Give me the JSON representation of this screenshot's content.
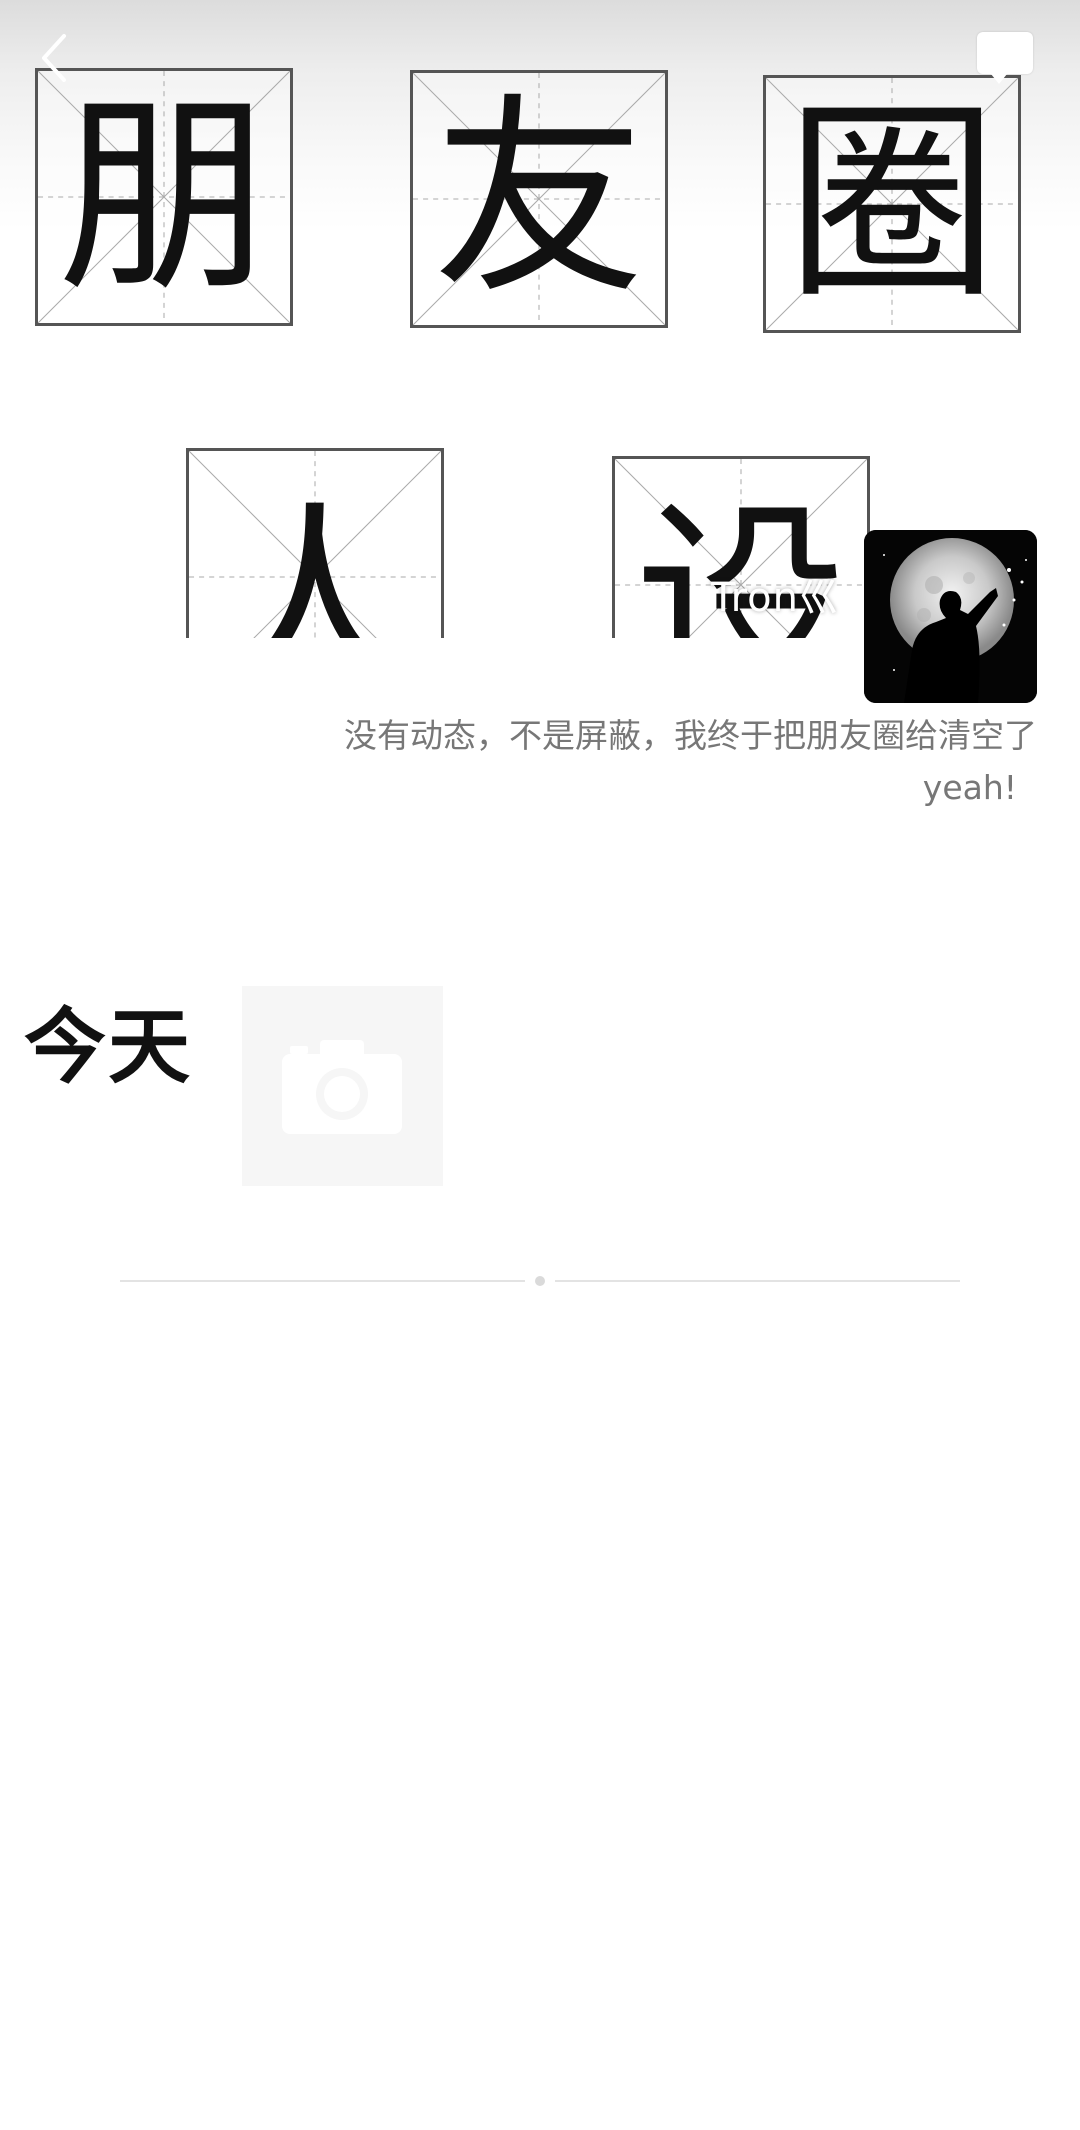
{
  "cover": {
    "row1": [
      "朋",
      "友",
      "圈"
    ],
    "row2": [
      "人",
      "设"
    ]
  },
  "nav": {
    "back_icon": "chevron-left-icon",
    "camera_icon": "camera-icon"
  },
  "profile": {
    "nickname": "Tron巛",
    "signature_line1": "没有动态，不是屏蔽，我终于把朋友圈给清空了",
    "signature_line2": "yeah!"
  },
  "timeline": {
    "today_label": "今天",
    "photo_icon": "camera-icon"
  },
  "colors": {
    "background": "#ffffff",
    "signature_text": "#777777",
    "title_text": "#111111"
  }
}
